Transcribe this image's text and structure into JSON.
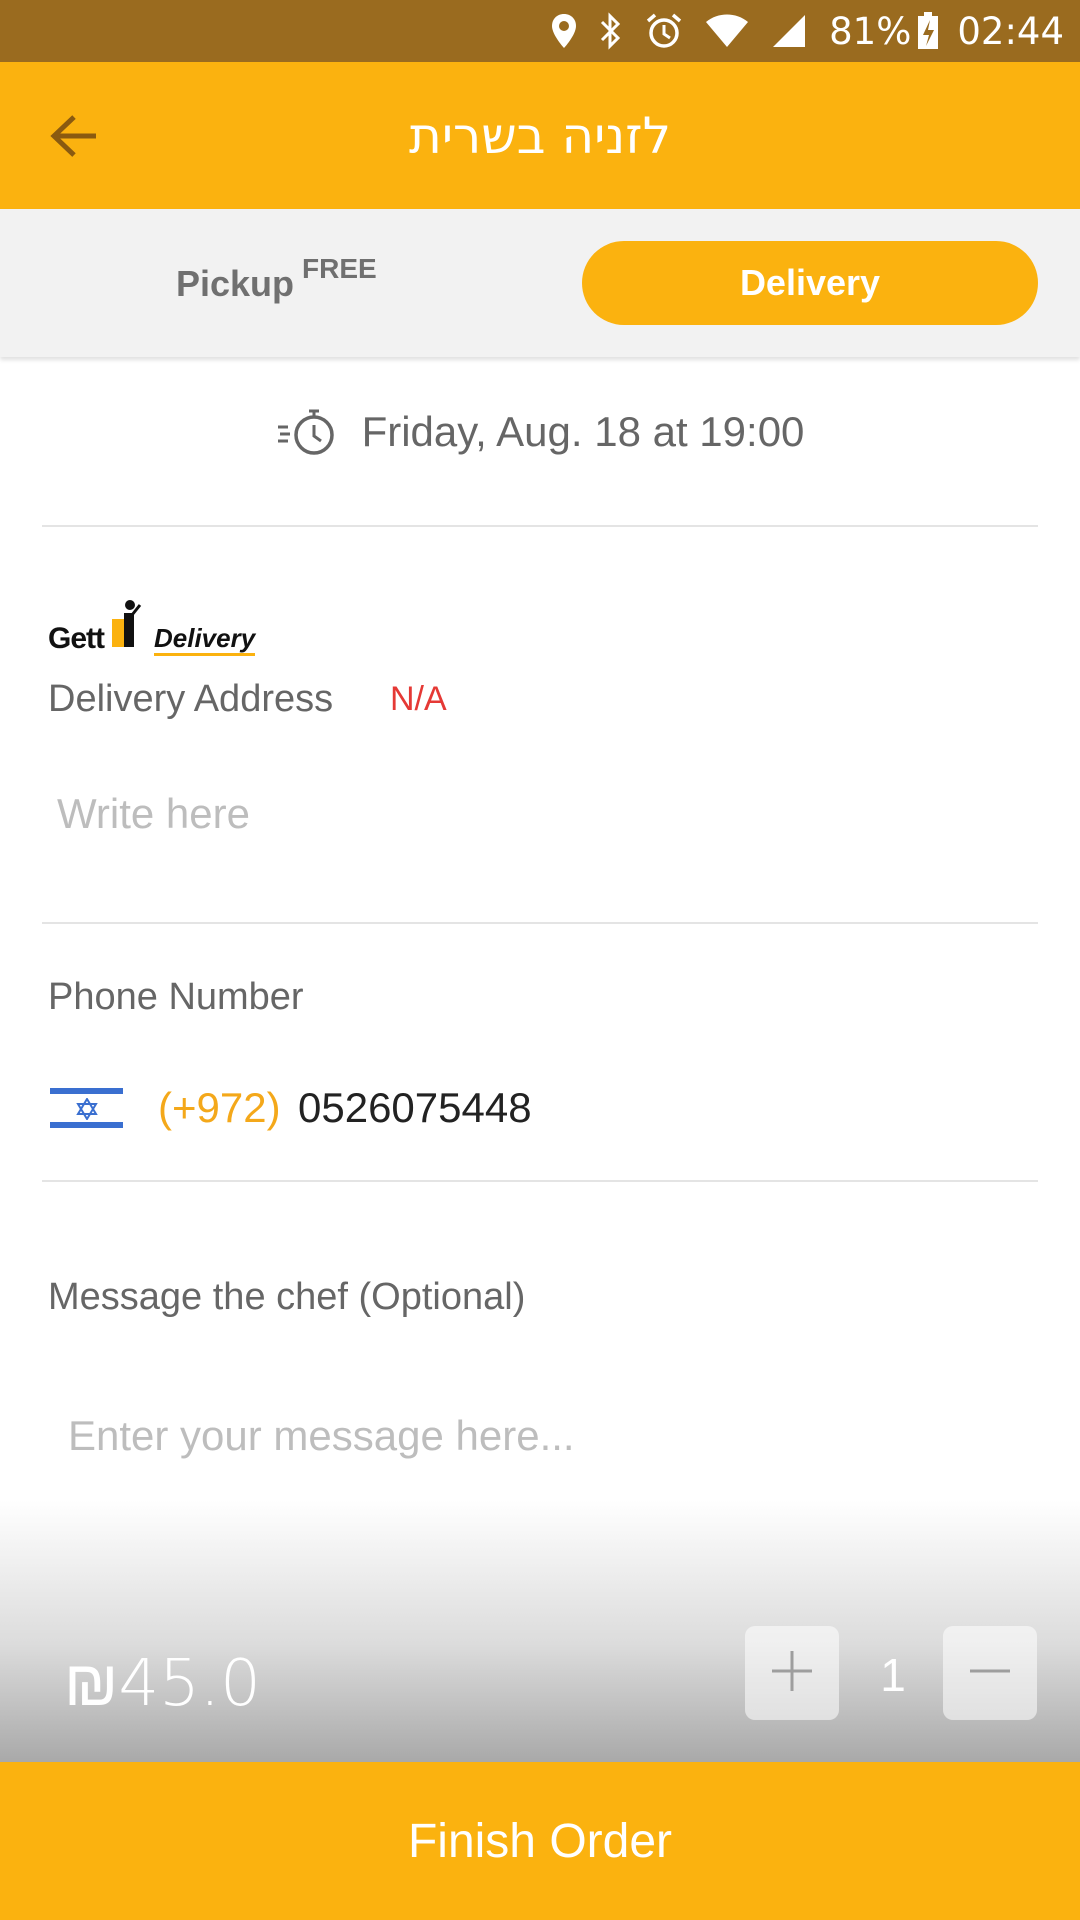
{
  "status_bar": {
    "battery": "81%",
    "time": "02:44"
  },
  "header": {
    "title": "לזניה בשרית"
  },
  "order_type": {
    "pickup_label": "Pickup",
    "pickup_badge": "FREE",
    "delivery_label": "Delivery",
    "selected": "Delivery"
  },
  "schedule": {
    "text": "Friday, Aug. 18 at 19:00"
  },
  "provider": {
    "brand": "Gett",
    "brand_sub": "Delivery"
  },
  "address": {
    "label": "Delivery Address",
    "status": "N/A",
    "placeholder": "Write here"
  },
  "phone": {
    "label": "Phone Number",
    "country_code": "(+972)",
    "number": "0526075448"
  },
  "message": {
    "label": "Message the chef (Optional)",
    "placeholder": "Enter your message here..."
  },
  "cart": {
    "price": "₪45.0",
    "quantity": "1"
  },
  "footer": {
    "finish_label": "Finish Order"
  },
  "colors": {
    "accent": "#fbb20f",
    "status_bar": "#9a6b1f",
    "error": "#e53935",
    "code": "#f4a81a"
  },
  "icons": [
    "back-arrow-icon",
    "location-icon",
    "bluetooth-icon",
    "alarm-icon",
    "wifi-icon",
    "signal-icon",
    "battery-icon",
    "timer-icon",
    "israel-flag-icon",
    "plus-icon",
    "minus-icon"
  ]
}
